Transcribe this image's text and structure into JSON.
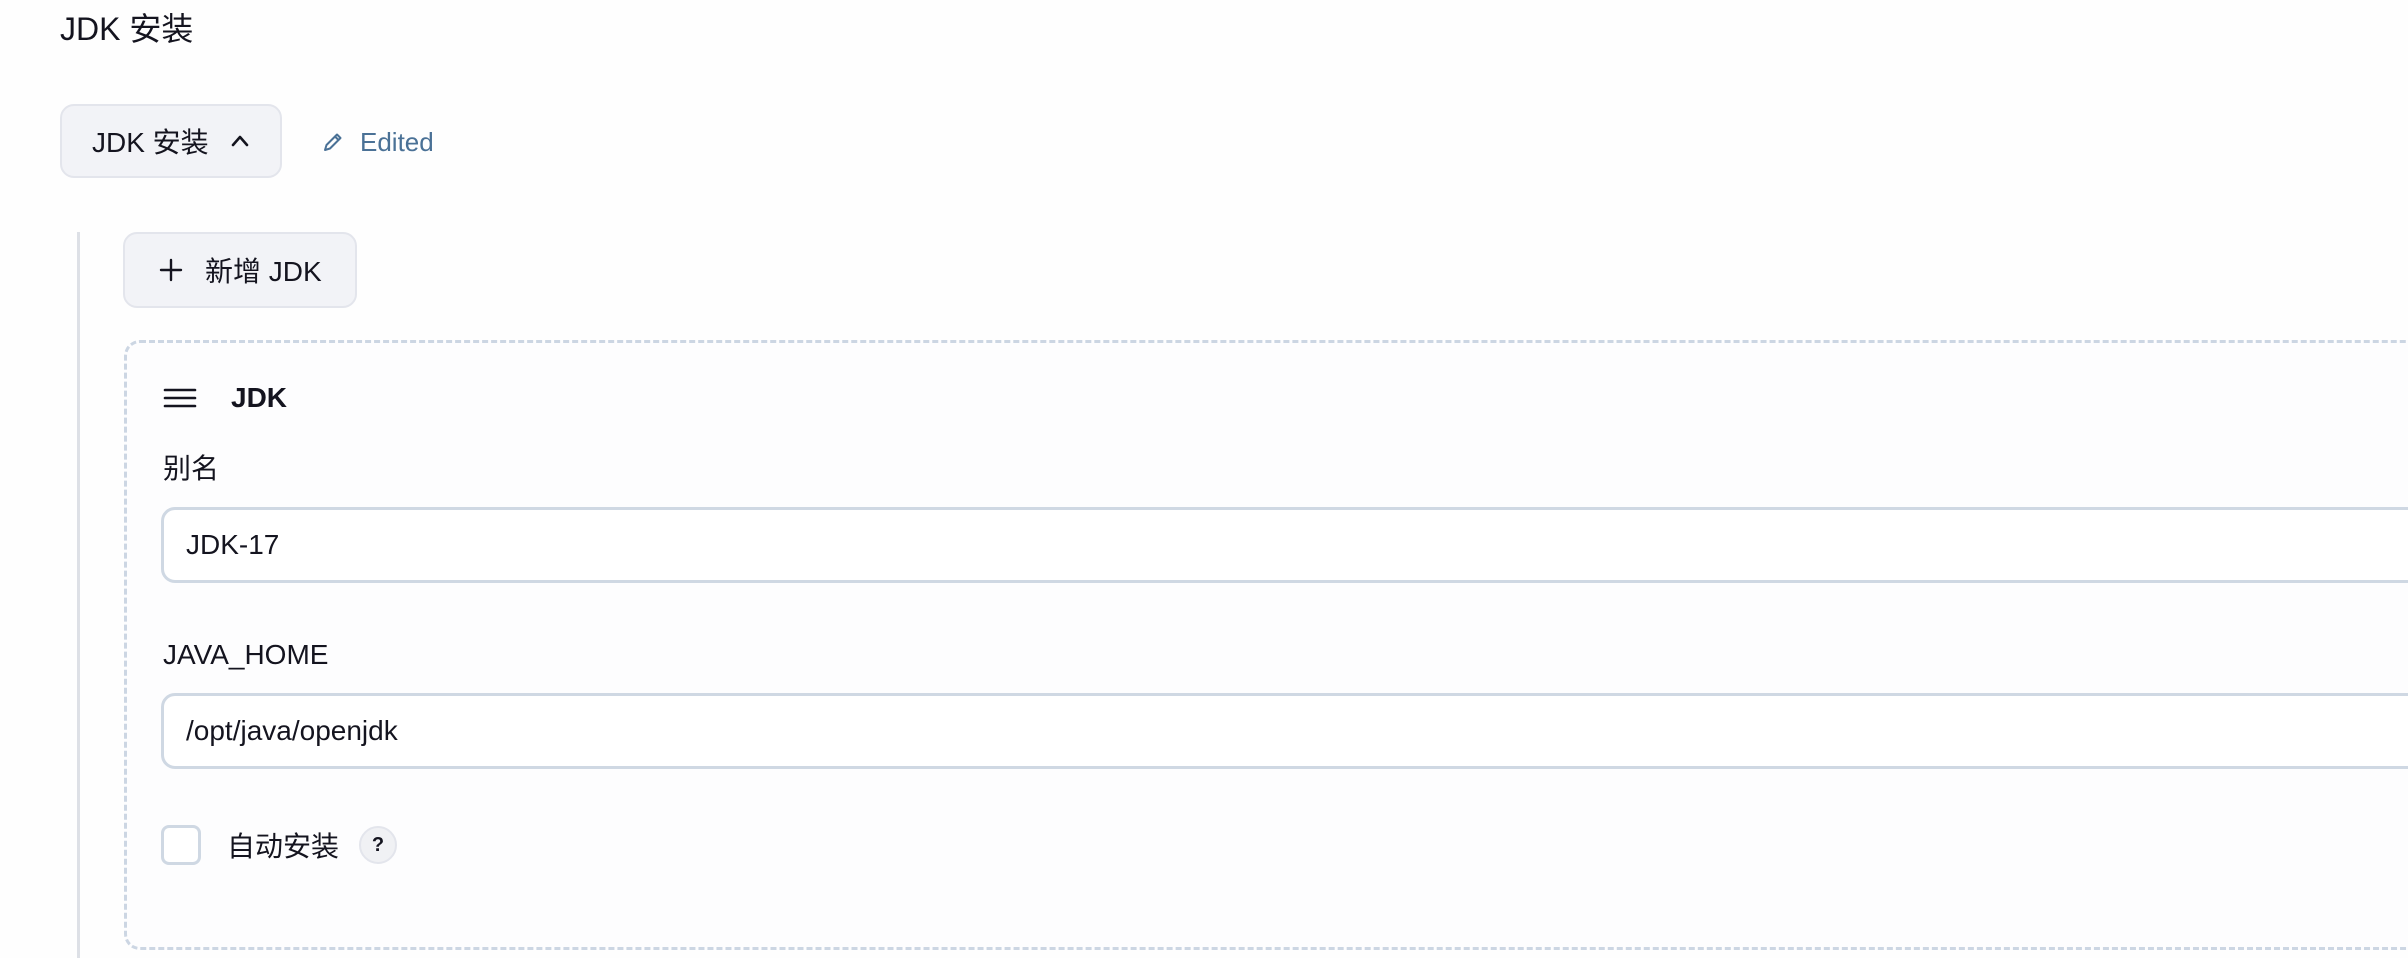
{
  "section": {
    "title": "JDK 安装"
  },
  "toggle": {
    "label": "JDK 安装",
    "icon": "chevron-up-icon"
  },
  "status": {
    "label": "Edited",
    "icon": "pencil-icon",
    "color": "#4a7196"
  },
  "add_button": {
    "label": "新增 JDK",
    "icon": "plus-icon"
  },
  "jdk_card": {
    "title": "JDK",
    "drag_icon": "drag-handle-icon",
    "alias": {
      "label": "别名",
      "value": "JDK-17"
    },
    "java_home": {
      "label": "JAVA_HOME",
      "value": "/opt/java/openjdk"
    },
    "auto_install": {
      "label": "自动安装",
      "checked": false,
      "help": "?"
    }
  }
}
